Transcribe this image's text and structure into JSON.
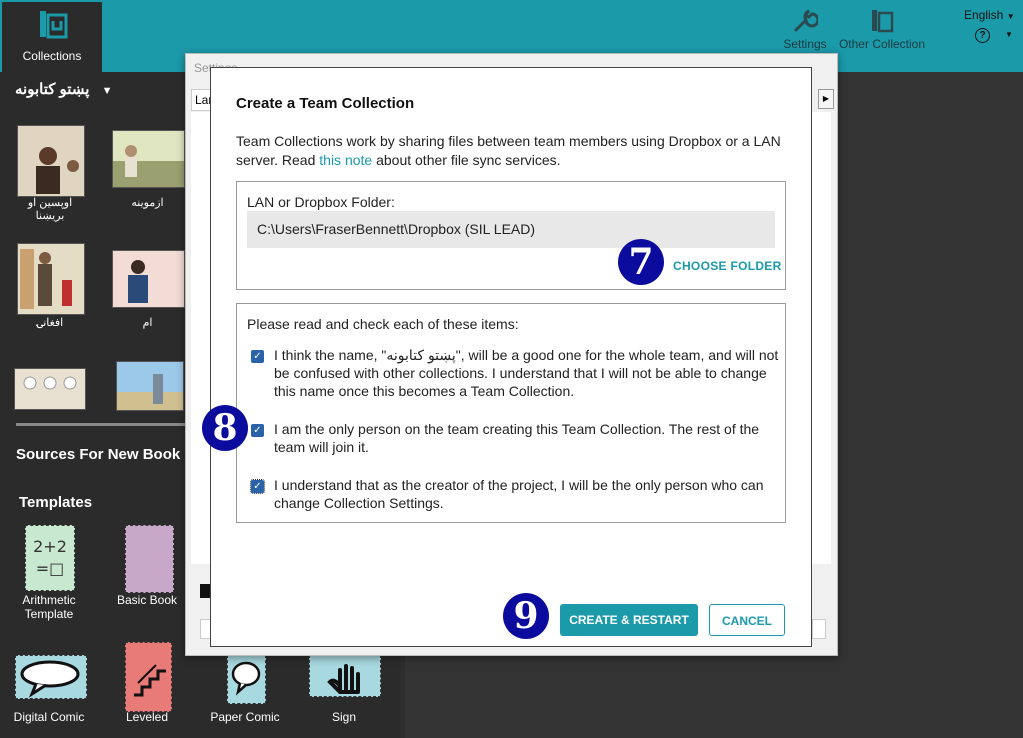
{
  "topbar": {
    "collections_label": "Collections",
    "settings_label": "Settings",
    "other_collection_label": "Other Collection",
    "language": "English"
  },
  "left": {
    "collection_title": "پښتو کتابونه",
    "books": [
      "اوپسین او بریښنا",
      "ازموینه",
      "افغانۍ",
      "ام"
    ],
    "sources_heading": "Sources For New Book",
    "templates_heading": "Templates",
    "templates": [
      "Arithmetic Template",
      "Basic Book",
      "Digital Comic",
      "Leveled",
      "Paper Comic",
      "Sign"
    ]
  },
  "settings": {
    "title": "Settings",
    "tab_partial": "Lar"
  },
  "dialog": {
    "title": "Create a Team Collection",
    "intro_before": "Team Collections work by sharing files between team members using Dropbox or a LAN server. Read ",
    "intro_link": "this note",
    "intro_after": " about other file sync services.",
    "folder_label": "LAN or Dropbox Folder:",
    "folder_value": "C:\\Users\\FraserBennett\\Dropbox (SIL LEAD)",
    "choose_folder": "CHOOSE FOLDER",
    "checks_heading": "Please read and check each of these items:",
    "check1": "I think the name, \"پښتو کتابونه\", will be a good one for the whole team, and will not be confused with other collections. I understand that I will not be able to change this name once this becomes a Team Collection.",
    "check2": "I am the only person on the team creating this Team Collection. The rest of the team will join it.",
    "check3": "I understand that as the creator of the project, I will be the only person who can change Collection Settings.",
    "create_button": "CREATE & RESTART",
    "cancel_button": "CANCEL"
  },
  "badges": {
    "b7": "7",
    "b8": "8",
    "b9": "9"
  }
}
